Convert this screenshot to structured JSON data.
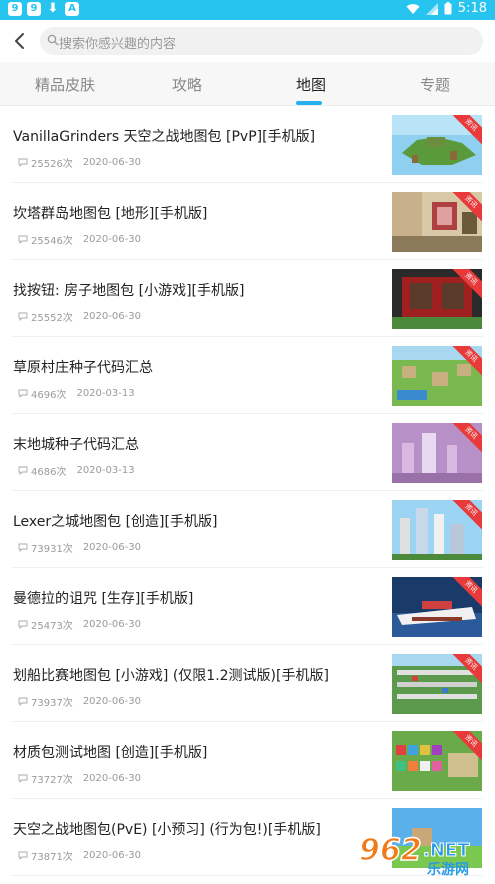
{
  "status": {
    "time": "5:18"
  },
  "search": {
    "placeholder": "搜索你感兴趣的内容"
  },
  "tabs": [
    {
      "label": "精品皮肤"
    },
    {
      "label": "攻略"
    },
    {
      "label": "地图"
    },
    {
      "label": "专题"
    }
  ],
  "badge_label": "资讯",
  "items": [
    {
      "title": "VanillaGrinders 天空之战地图包 [PvP][手机版]",
      "count": "25526次",
      "date": "2020-06-30"
    },
    {
      "title": "坎塔群岛地图包 [地形][手机版]",
      "count": "25546次",
      "date": "2020-06-30"
    },
    {
      "title": "找按钮: 房子地图包 [小游戏][手机版]",
      "count": "25552次",
      "date": "2020-06-30"
    },
    {
      "title": "草原村庄种子代码汇总",
      "count": "4696次",
      "date": "2020-03-13"
    },
    {
      "title": "末地城种子代码汇总",
      "count": "4686次",
      "date": "2020-03-13"
    },
    {
      "title": "Lexer之城地图包 [创造][手机版]",
      "count": "73931次",
      "date": "2020-06-30"
    },
    {
      "title": "曼德拉的诅咒 [生存][手机版]",
      "count": "25473次",
      "date": "2020-06-30"
    },
    {
      "title": "划船比赛地图包 [小游戏] (仅限1.2测试版)[手机版]",
      "count": "73937次",
      "date": "2020-06-30"
    },
    {
      "title": "材质包测试地图 [创造][手机版]",
      "count": "73727次",
      "date": "2020-06-30"
    },
    {
      "title": "天空之战地图包(PvE) [小预习] (行为包!)[手机版]",
      "count": "73871次",
      "date": "2020-06-30"
    }
  ],
  "watermark": {
    "text": "962.NET",
    "sub": "乐游网"
  },
  "colors": {
    "statusbar": "#28c4f0",
    "accent": "#28b0ef",
    "badge": "#e83a3a"
  }
}
